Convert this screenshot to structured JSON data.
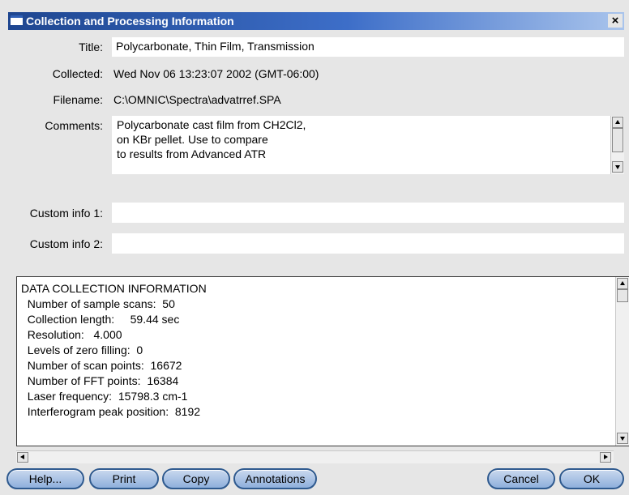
{
  "window": {
    "title": "Collection and Processing Information",
    "close_glyph": "×"
  },
  "form": {
    "title_label": "Title:",
    "title_value": "Polycarbonate, Thin Film, Transmission",
    "collected_label": "Collected:",
    "collected_value": "Wed Nov 06 13:23:07 2002 (GMT-06:00)",
    "filename_label": "Filename:",
    "filename_value": "C:\\OMNIC\\Spectra\\advatrref.SPA",
    "comments_label": "Comments:",
    "comments_lines": [
      "Polycarbonate cast film from CH2Cl2,",
      "on KBr pellet. Use to compare",
      "to results from Advanced ATR"
    ],
    "custom1_label": "Custom info 1:",
    "custom1_value": "",
    "custom2_label": "Custom info 2:",
    "custom2_value": ""
  },
  "info": {
    "lines": [
      "DATA COLLECTION INFORMATION",
      "  Number of sample scans:  50",
      "  Collection length:     59.44 sec",
      "  Resolution:   4.000",
      "  Levels of zero filling:  0",
      "  Number of scan points:  16672",
      "  Number of FFT points:  16384",
      "  Laser frequency:  15798.3 cm-1",
      "  Interferogram peak position:  8192"
    ]
  },
  "buttons": {
    "help": "Help...",
    "print": "Print",
    "copy": "Copy",
    "annotations": "Annotations",
    "cancel": "Cancel",
    "ok": "OK"
  },
  "colors": {
    "titlebar": "#1e4690",
    "button_fill": "#a6c0e6",
    "button_border": "#2f5a8f",
    "dialog_bg": "#e6e6e6"
  }
}
